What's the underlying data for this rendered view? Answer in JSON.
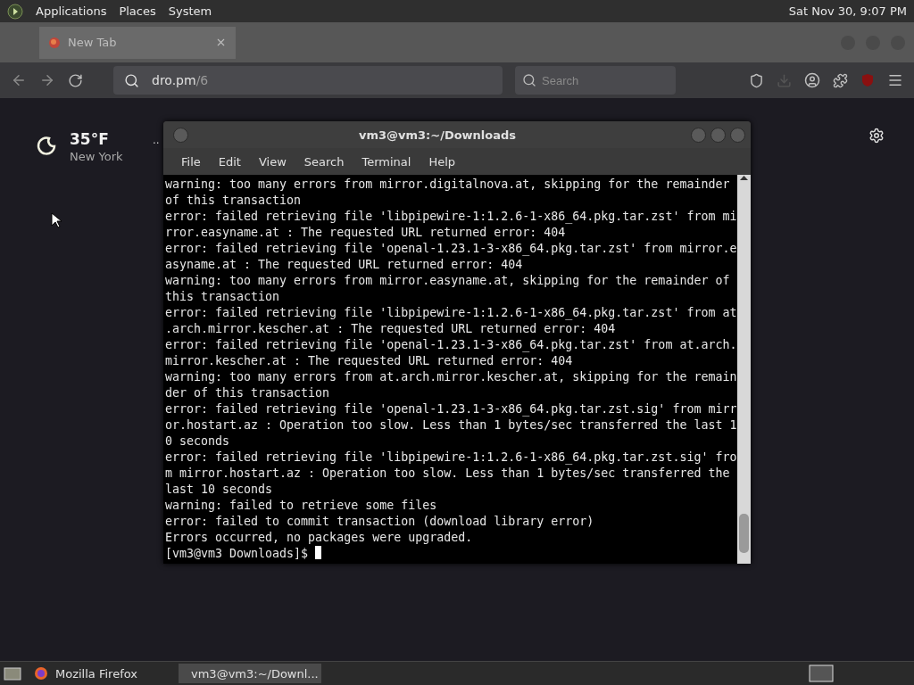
{
  "top_panel": {
    "menus": [
      "Applications",
      "Places",
      "System"
    ],
    "clock": "Sat Nov 30,  9:07 PM"
  },
  "browser": {
    "tabs": [
      {
        "label": "New Tab",
        "selected": true
      }
    ],
    "url_host": "dro.pm",
    "url_path": "/6",
    "search": {
      "placeholder": "Search"
    },
    "weather": {
      "temperature": "35°F",
      "location": "New York"
    },
    "more": "··"
  },
  "terminal": {
    "title": "vm3@vm3:~/Downloads",
    "menu": [
      "File",
      "Edit",
      "View",
      "Search",
      "Terminal",
      "Help"
    ],
    "lines": [
      "warning: too many errors from mirror.digitalnova.at, skipping for the remainder",
      "of this transaction",
      "error: failed retrieving file 'libpipewire-1:1.2.6-1-x86_64.pkg.tar.zst' from mi",
      "rror.easyname.at : The requested URL returned error: 404",
      "error: failed retrieving file 'openal-1.23.1-3-x86_64.pkg.tar.zst' from mirror.e",
      "asyname.at : The requested URL returned error: 404",
      "warning: too many errors from mirror.easyname.at, skipping for the remainder of",
      "this transaction",
      "error: failed retrieving file 'libpipewire-1:1.2.6-1-x86_64.pkg.tar.zst' from at",
      ".arch.mirror.kescher.at : The requested URL returned error: 404",
      "error: failed retrieving file 'openal-1.23.1-3-x86_64.pkg.tar.zst' from at.arch.",
      "mirror.kescher.at : The requested URL returned error: 404",
      "warning: too many errors from at.arch.mirror.kescher.at, skipping for the remain",
      "der of this transaction",
      "error: failed retrieving file 'openal-1.23.1-3-x86_64.pkg.tar.zst.sig' from mirr",
      "or.hostart.az : Operation too slow. Less than 1 bytes/sec transferred the last 1",
      "0 seconds",
      "error: failed retrieving file 'libpipewire-1:1.2.6-1-x86_64.pkg.tar.zst.sig' fro",
      "m mirror.hostart.az : Operation too slow. Less than 1 bytes/sec transferred the",
      "last 10 seconds",
      "warning: failed to retrieve some files",
      "error: failed to commit transaction (download library error)",
      "Errors occurred, no packages were upgraded."
    ],
    "prompt": "[vm3@vm3 Downloads]$ "
  },
  "taskbar": [
    {
      "label": "Mozilla Firefox",
      "kind": "firefox",
      "selected": false
    },
    {
      "label": "vm3@vm3:~/Downl...",
      "kind": "terminal",
      "selected": true
    }
  ]
}
